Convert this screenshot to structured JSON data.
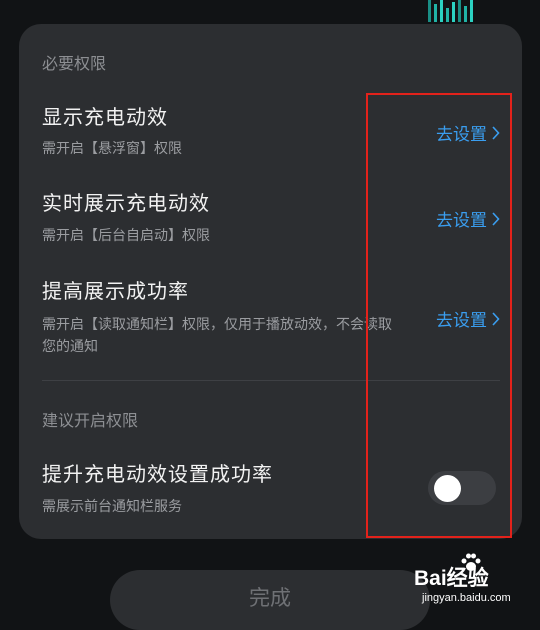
{
  "required_section": {
    "title": "必要权限",
    "items": [
      {
        "title": "显示充电动效",
        "desc": "需开启【悬浮窗】权限",
        "action": "去设置"
      },
      {
        "title": "实时展示充电动效",
        "desc": "需开启【后台自启动】权限",
        "action": "去设置"
      },
      {
        "title": "提高展示成功率",
        "desc": "需开启【读取通知栏】权限，仅用于播放动效，不会读取您的通知",
        "action": "去设置"
      }
    ]
  },
  "suggested_section": {
    "title": "建议开启权限",
    "item": {
      "title": "提升充电动效设置成功率",
      "desc": "需展示前台通知栏服务",
      "toggle_on": false
    }
  },
  "done_button": "完成",
  "watermark": {
    "brand": "Bai经验",
    "url": "jingyan.baidu.com"
  },
  "colors": {
    "accent": "#3a9ef0",
    "highlight": "#e3221b",
    "card": "#2c2e31",
    "background": "#111315"
  }
}
